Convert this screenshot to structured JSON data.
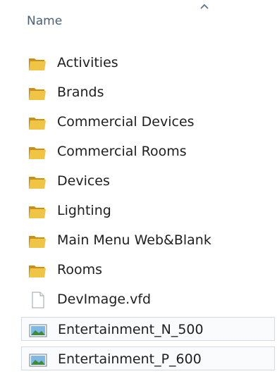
{
  "header": {
    "name_label": "Name"
  },
  "items": [
    {
      "label": "Activities",
      "type": "folder"
    },
    {
      "label": "Brands",
      "type": "folder"
    },
    {
      "label": "Commercial Devices",
      "type": "folder"
    },
    {
      "label": "Commercial Rooms",
      "type": "folder"
    },
    {
      "label": "Devices",
      "type": "folder"
    },
    {
      "label": "Lighting",
      "type": "folder"
    },
    {
      "label": "Main Menu Web&Blank",
      "type": "folder"
    },
    {
      "label": "Rooms",
      "type": "folder"
    },
    {
      "label": "DevImage.vfd",
      "type": "file"
    },
    {
      "label": "Entertainment_N_500",
      "type": "image"
    },
    {
      "label": "Entertainment_P_600",
      "type": "image"
    }
  ],
  "colors": {
    "folder": "#e8b632",
    "header_text": "#4a5f7a"
  }
}
